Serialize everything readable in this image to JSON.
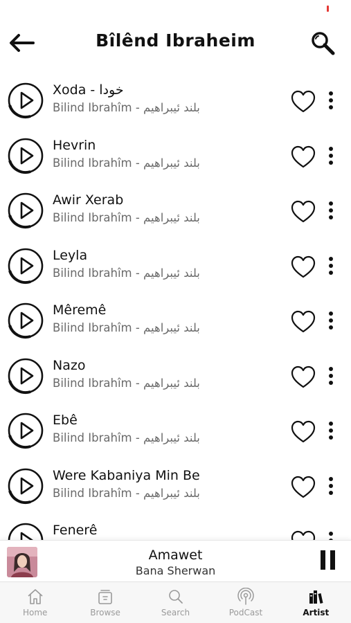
{
  "header": {
    "title": "Bîlênd Ibraheim",
    "back_icon": "arrow-left-icon",
    "search_icon": "search-icon"
  },
  "songs": [
    {
      "title": "Xoda - خودا",
      "artist": "Bilind Ibrahîm - بلند ئیبراهیم"
    },
    {
      "title": "Hevrin",
      "artist": "Bilind Ibrahîm - بلند ئیبراهیم"
    },
    {
      "title": "Awir Xerab",
      "artist": "Bilind Ibrahîm - بلند ئیبراهیم"
    },
    {
      "title": "Leyla",
      "artist": "Bilind Ibrahîm - بلند ئیبراهیم"
    },
    {
      "title": "Mêremê",
      "artist": "Bilind Ibrahîm - بلند ئیبراهیم"
    },
    {
      "title": "Nazo",
      "artist": "Bilind Ibrahîm - بلند ئیبراهیم"
    },
    {
      "title": "Ebê",
      "artist": "Bilind Ibrahîm - بلند ئیبراهیم"
    },
    {
      "title": "Were Kabaniya Min Be",
      "artist": "Bilind Ibrahîm - بلند ئیبراهیم"
    },
    {
      "title": "Fenerê",
      "artist": ""
    }
  ],
  "now_playing": {
    "title": "Amawet",
    "artist": "Bana Sherwan",
    "state": "playing"
  },
  "tabs": [
    {
      "label": "Home",
      "icon": "home-icon",
      "active": false
    },
    {
      "label": "Browse",
      "icon": "browse-icon",
      "active": false
    },
    {
      "label": "Search",
      "icon": "search-icon",
      "active": false
    },
    {
      "label": "PodCast",
      "icon": "podcast-icon",
      "active": false
    },
    {
      "label": "Artist",
      "icon": "artist-icon",
      "active": true
    }
  ],
  "colors": {
    "accent": "#111111",
    "muted_text": "#6a6a6a",
    "inactive_tab": "#9a9a9a",
    "status_indicator": "#e53935"
  }
}
